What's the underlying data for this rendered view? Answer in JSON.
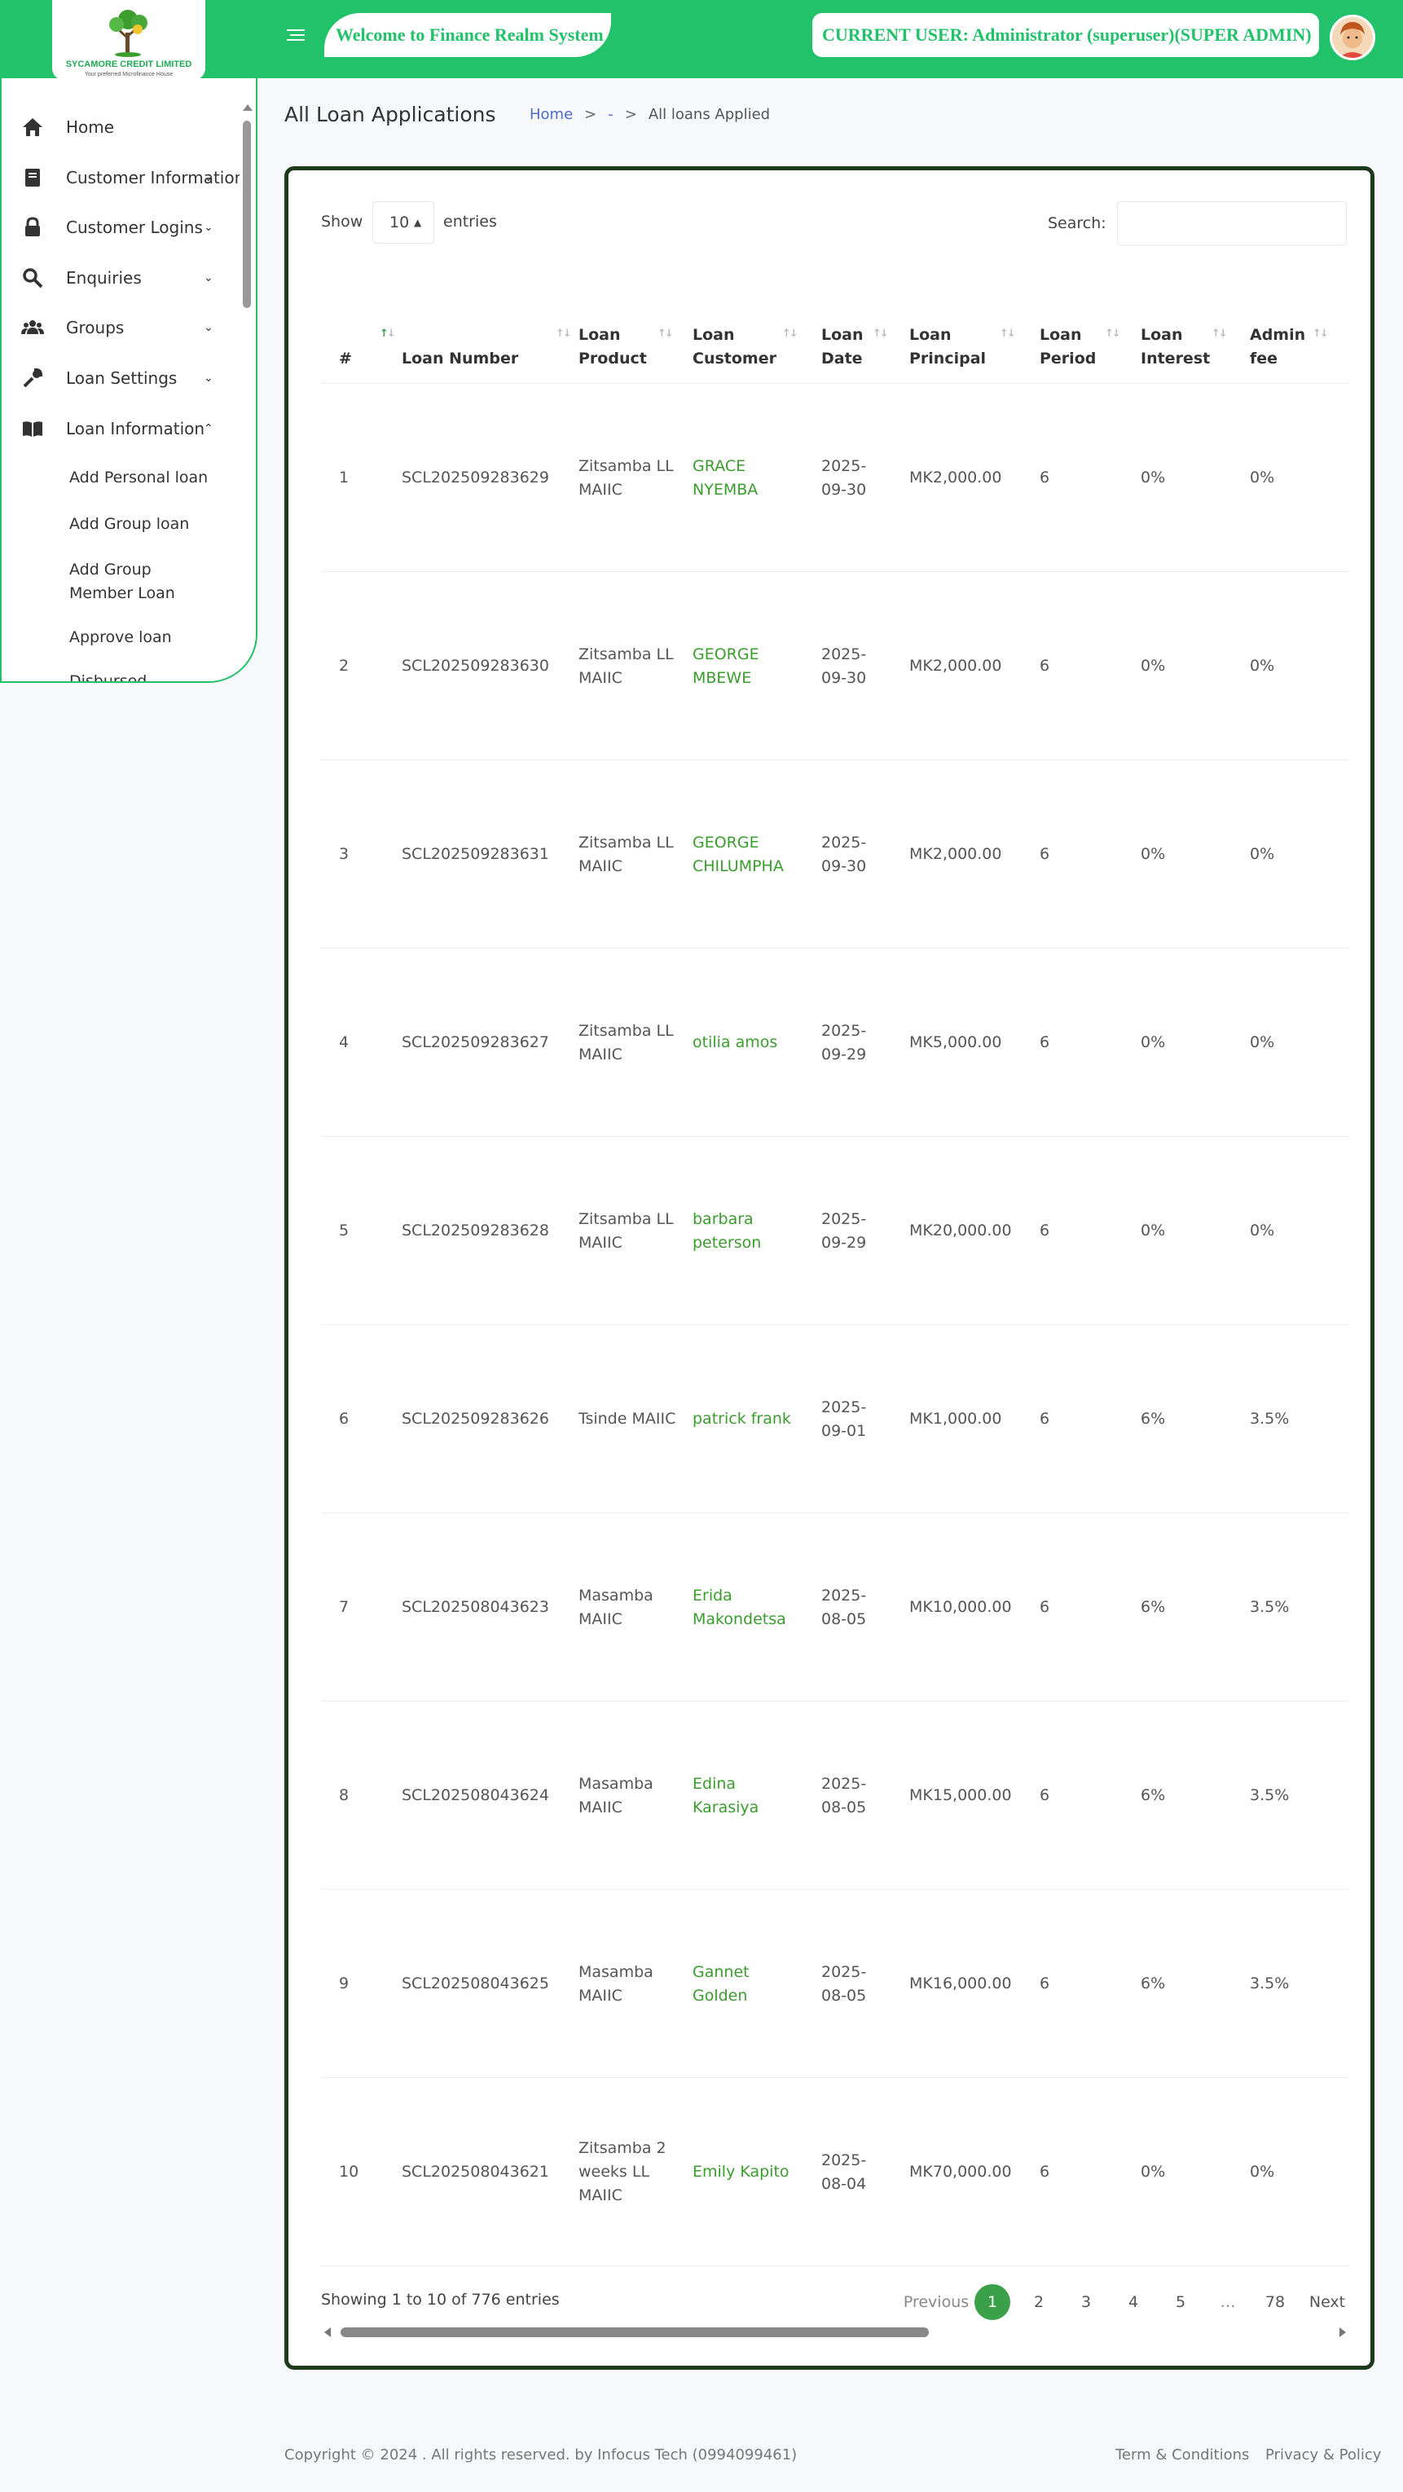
{
  "header": {
    "logo_name": "SYCAMORE CREDIT LIMITED",
    "logo_tagline": "Your preferred Microfinance House",
    "welcome": "Welcome to Finance Realm System",
    "current_user": "CURRENT USER: Administrator (superuser)(SUPER ADMIN)",
    "accent_color": "#22c26a"
  },
  "sidebar": {
    "items": [
      {
        "label": "Home",
        "icon": "home-icon"
      },
      {
        "label": "Customer Information",
        "icon": "book-icon"
      },
      {
        "label": "Customer Logins",
        "icon": "lock-icon"
      },
      {
        "label": "Enquiries",
        "icon": "search-icon"
      },
      {
        "label": "Groups",
        "icon": "users-icon"
      },
      {
        "label": "Loan Settings",
        "icon": "wrench-icon"
      },
      {
        "label": "Loan Information",
        "icon": "open-book-icon"
      }
    ],
    "sub_items": [
      "Add Personal loan",
      "Add Group loan",
      "Add Group Member Loan",
      "Approve loan",
      "Disbursed"
    ]
  },
  "page": {
    "title": "All Loan Applications",
    "breadcrumb": [
      "Home",
      "-",
      "All loans Applied"
    ]
  },
  "table_controls": {
    "show_label": "Show",
    "page_length": "10",
    "entries_label": "entries",
    "search_label": "Search:"
  },
  "table": {
    "columns": [
      "#",
      "Loan Number",
      "Loan Product",
      "Loan Customer",
      "Loan Date",
      "Loan Principal",
      "Loan Period",
      "Loan Interest",
      "Admin fee"
    ],
    "rows": [
      {
        "n": "1",
        "number": "SCL202509283629",
        "product": "Zitsamba LL MAIIC",
        "customer": "GRACE NYEMBA",
        "date": "2025-09-30",
        "principal": "MK2,000.00",
        "period": "6",
        "interest": "0%",
        "admin_fee": "0%"
      },
      {
        "n": "2",
        "number": "SCL202509283630",
        "product": "Zitsamba LL MAIIC",
        "customer": "GEORGE MBEWE",
        "date": "2025-09-30",
        "principal": "MK2,000.00",
        "period": "6",
        "interest": "0%",
        "admin_fee": "0%"
      },
      {
        "n": "3",
        "number": "SCL202509283631",
        "product": "Zitsamba LL MAIIC",
        "customer": "GEORGE CHILUMPHA",
        "date": "2025-09-30",
        "principal": "MK2,000.00",
        "period": "6",
        "interest": "0%",
        "admin_fee": "0%"
      },
      {
        "n": "4",
        "number": "SCL202509283627",
        "product": "Zitsamba LL MAIIC",
        "customer": "otilia amos",
        "date": "2025-09-29",
        "principal": "MK5,000.00",
        "period": "6",
        "interest": "0%",
        "admin_fee": "0%"
      },
      {
        "n": "5",
        "number": "SCL202509283628",
        "product": "Zitsamba LL MAIIC",
        "customer": "barbara peterson",
        "date": "2025-09-29",
        "principal": "MK20,000.00",
        "period": "6",
        "interest": "0%",
        "admin_fee": "0%"
      },
      {
        "n": "6",
        "number": "SCL202509283626",
        "product": "Tsinde MAIIC",
        "customer": "patrick frank",
        "date": "2025-09-01",
        "principal": "MK1,000.00",
        "period": "6",
        "interest": "6%",
        "admin_fee": "3.5%"
      },
      {
        "n": "7",
        "number": "SCL202508043623",
        "product": "Masamba MAIIC",
        "customer": "Erida Makondetsa",
        "date": "2025-08-05",
        "principal": "MK10,000.00",
        "period": "6",
        "interest": "6%",
        "admin_fee": "3.5%"
      },
      {
        "n": "8",
        "number": "SCL202508043624",
        "product": "Masamba MAIIC",
        "customer": "Edina Karasiya",
        "date": "2025-08-05",
        "principal": "MK15,000.00",
        "period": "6",
        "interest": "6%",
        "admin_fee": "3.5%"
      },
      {
        "n": "9",
        "number": "SCL202508043625",
        "product": "Masamba MAIIC",
        "customer": "Gannet Golden",
        "date": "2025-08-05",
        "principal": "MK16,000.00",
        "period": "6",
        "interest": "6%",
        "admin_fee": "3.5%"
      },
      {
        "n": "10",
        "number": "SCL202508043621",
        "product": "Zitsamba 2 weeks LL MAIIC",
        "customer": "Emily Kapito",
        "date": "2025-08-04",
        "principal": "MK70,000.00",
        "period": "6",
        "interest": "0%",
        "admin_fee": "0%"
      }
    ]
  },
  "pagination": {
    "info": "Showing 1 to 10 of 776 entries",
    "previous": "Previous",
    "pages": [
      "1",
      "2",
      "3",
      "4",
      "5",
      "…",
      "78"
    ],
    "next": "Next",
    "current": "1"
  },
  "footer": {
    "copyright": "Copyright © 2024 . All rights reserved. by Infocus Tech (0994099461)",
    "links": [
      "Term & Conditions",
      "Privacy & Policy"
    ]
  }
}
